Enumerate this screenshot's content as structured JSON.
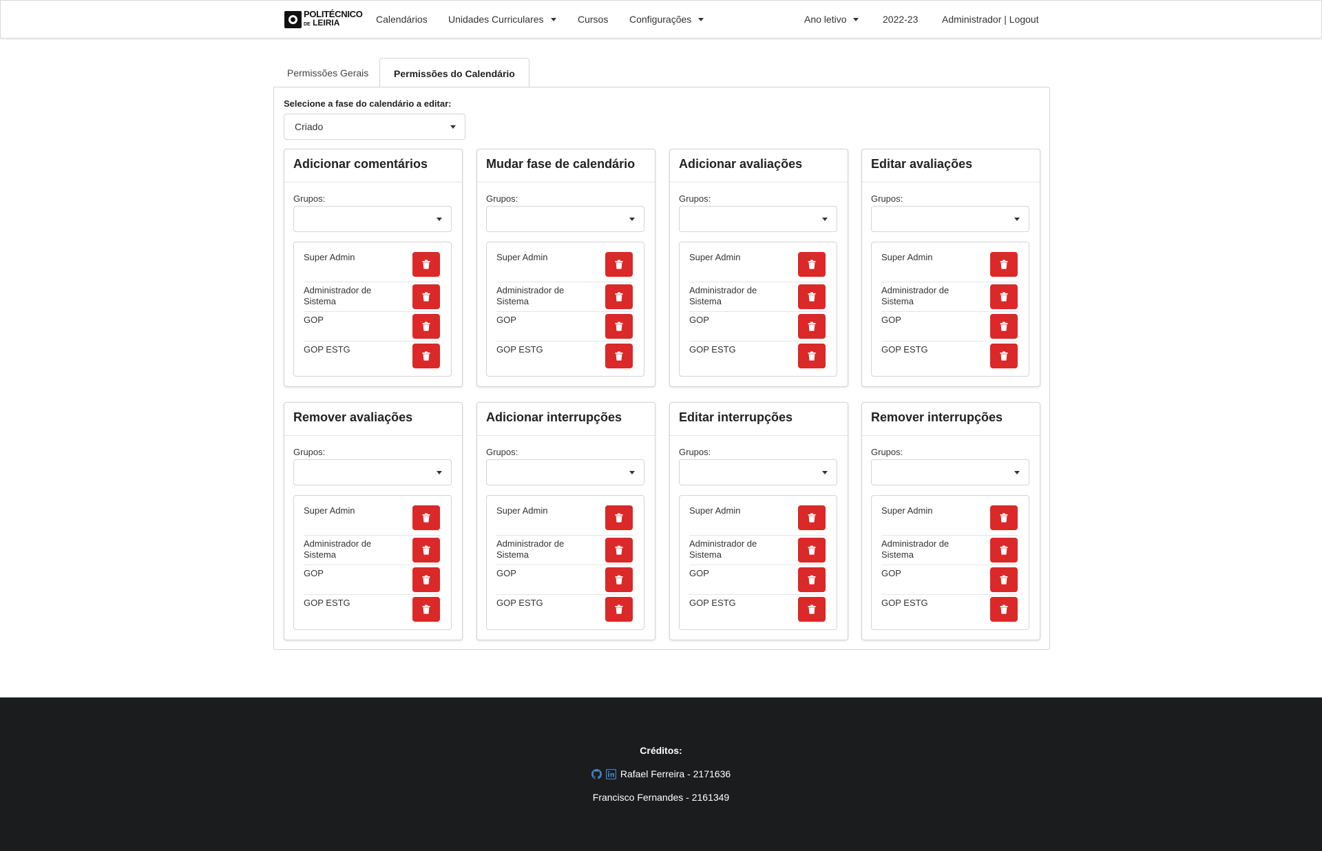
{
  "nav": {
    "logo_line1": "POLITÉCNICO",
    "logo_line2_prefix": "DE",
    "logo_line2": "LEIRIA",
    "items": [
      {
        "label": "Calendários"
      },
      {
        "label": "Unidades Curriculares"
      },
      {
        "label": "Cursos"
      },
      {
        "label": "Configurações"
      }
    ],
    "ano_letivo": "Ano letivo",
    "year": "2022-23",
    "user": "Administrador | Logout"
  },
  "tabs": [
    {
      "label": "Permissões Gerais"
    },
    {
      "label": "Permissões do Calendário"
    }
  ],
  "active_tab": "Permissões do Calendário",
  "phase": {
    "label": "Selecione a fase do calendário a editar:",
    "value": "Criado"
  },
  "groups_label": "Grupos:",
  "groups_select_value": "",
  "group_names": [
    "Super Admin",
    "Administrador de Sistema",
    "GOP",
    "GOP ESTG"
  ],
  "cards": [
    {
      "title": "Adicionar comentários"
    },
    {
      "title": "Mudar fase de calendário"
    },
    {
      "title": "Adicionar avaliações"
    },
    {
      "title": "Editar avaliações"
    },
    {
      "title": "Remover avaliações"
    },
    {
      "title": "Adicionar interrupções"
    },
    {
      "title": "Editar interrupções"
    },
    {
      "title": "Remover interrupções"
    }
  ],
  "footer": {
    "credits_title": "Créditos:",
    "credit_1": "Rafael Ferreira - 2171636",
    "credit_2": "Francisco Fernandes - 2161349"
  },
  "colors": {
    "delete_button": "#db2828",
    "footer_bg": "#1b1c1d",
    "link_icon": "#4183c4"
  },
  "icons": {
    "delete": "trash-icon",
    "github": "github-icon",
    "linkedin": "linkedin-icon"
  }
}
